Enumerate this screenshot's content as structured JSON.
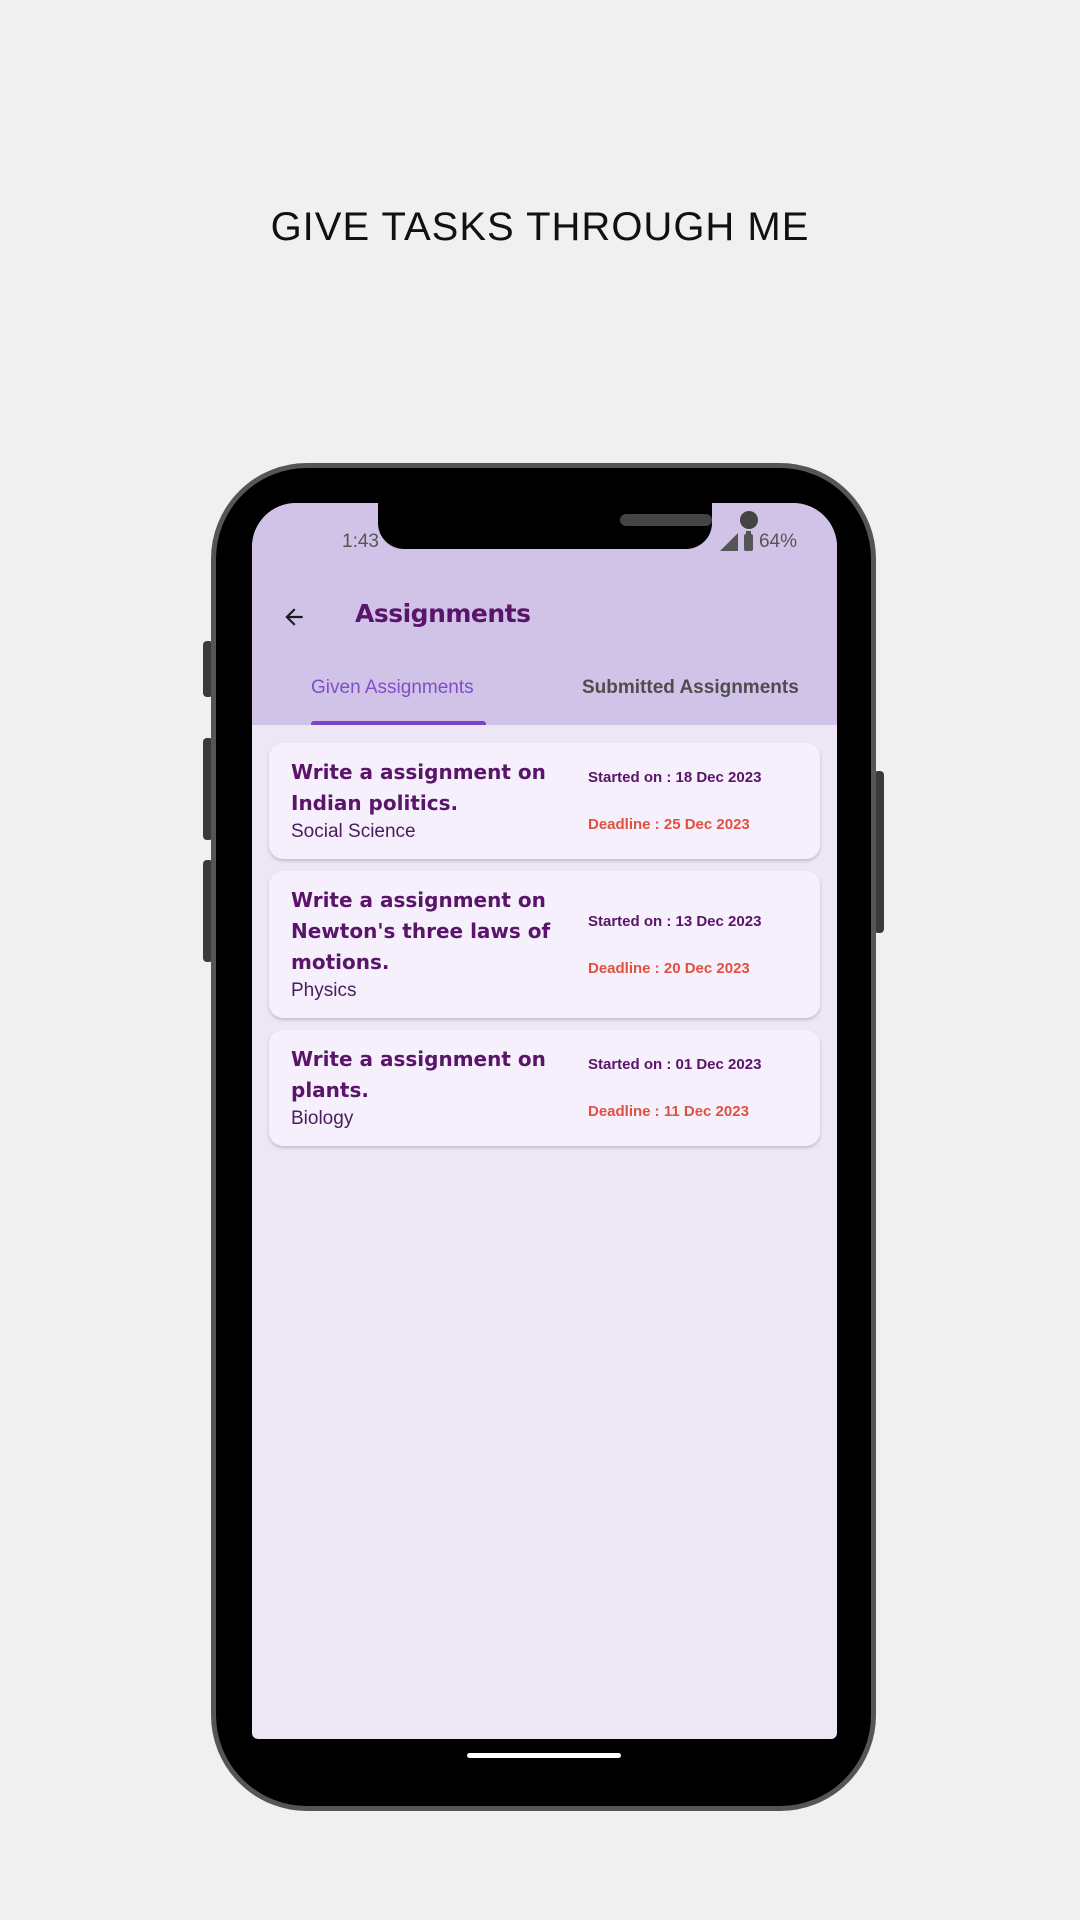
{
  "headline": "GIVE TASKS THROUGH ME",
  "status_bar": {
    "time": "1:43",
    "battery": "64%"
  },
  "app_bar": {
    "title": "Assignments"
  },
  "tabs": [
    {
      "label": "Given Assignments",
      "selected": true
    },
    {
      "label": "Submitted Assignments",
      "selected": false
    }
  ],
  "assignments": [
    {
      "title": "Write a assignment on Indian politics.",
      "subject": "Social Science",
      "started": "Started on : 18 Dec 2023",
      "deadline": "Deadline : 25 Dec 2023"
    },
    {
      "title": "Write a assignment on Newton's three laws of motions.",
      "subject": "Physics",
      "started": "Started on : 13 Dec 2023",
      "deadline": "Deadline : 20 Dec 2023"
    },
    {
      "title": "Write a assignment on plants.",
      "subject": "Biology",
      "started": "Started on : 01 Dec 2023",
      "deadline": "Deadline : 11 Dec 2023"
    }
  ],
  "colors": {
    "app_bar": "#d1c3e8",
    "accent": "#7a45c4",
    "title": "#5a1469",
    "deadline": "#e0523e",
    "background": "#ece6f5"
  },
  "icons": {
    "back": "arrow-left-icon",
    "signal": "cell-signal-icon",
    "battery": "battery-icon"
  }
}
